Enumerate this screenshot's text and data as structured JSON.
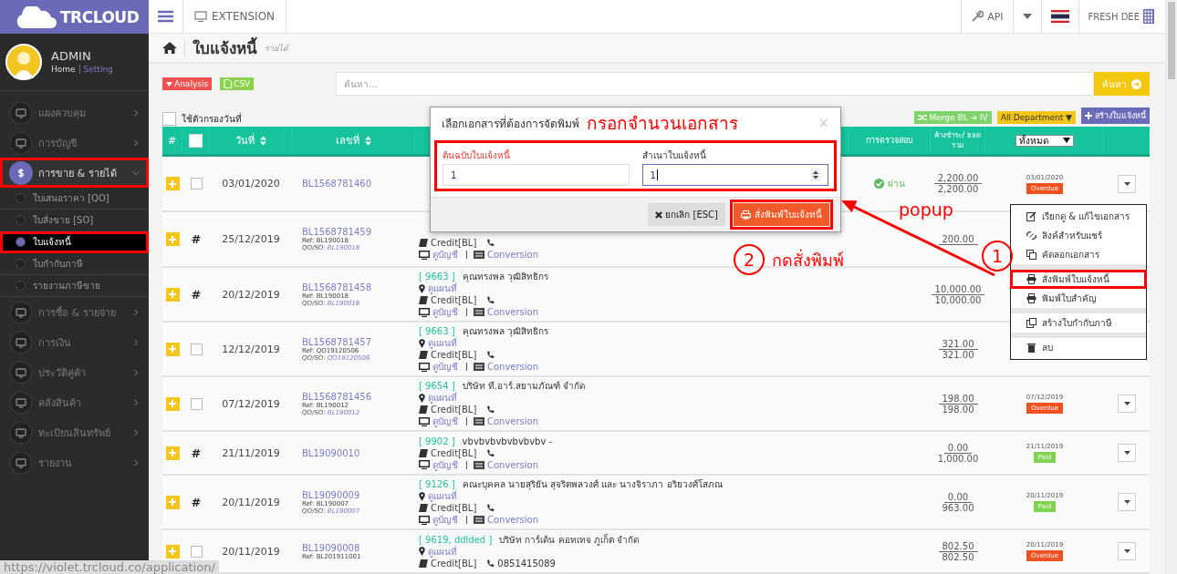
{
  "logo": "TRCLOUD",
  "profile": {
    "name": "ADMIN",
    "home": "Home",
    "setting": "Setting"
  },
  "sidebar": {
    "items": [
      {
        "label": "แผงควบคุม",
        "expanded": false,
        "highlighted": false
      },
      {
        "label": "การบัญชี",
        "expanded": false,
        "highlighted": false
      },
      {
        "label": "การขาย & รายได้",
        "expanded": true,
        "highlighted": true,
        "children": [
          {
            "label": "ใบเสนอราคา [QO]",
            "selected": false,
            "highlighted": false
          },
          {
            "label": "ใบสั่งขาย [SO]",
            "selected": false,
            "highlighted": false
          },
          {
            "label": "ใบแจ้งหนี้",
            "selected": true,
            "highlighted": true
          },
          {
            "label": "ใบกำกับภาษี",
            "selected": false,
            "highlighted": false
          },
          {
            "label": "รายงานภาษีขาย",
            "selected": false,
            "highlighted": false
          }
        ]
      },
      {
        "label": "การซื้อ & รายจ่าย",
        "expanded": false,
        "highlighted": false
      },
      {
        "label": "การเงิน",
        "expanded": false,
        "highlighted": false
      },
      {
        "label": "ประวัติคู่ค้า",
        "expanded": false,
        "highlighted": false
      },
      {
        "label": "คลังสินค้า",
        "expanded": false,
        "highlighted": false
      },
      {
        "label": "ทะเบียนสินทรัพย์",
        "expanded": false,
        "highlighted": false
      },
      {
        "label": "รายงาน",
        "expanded": false,
        "highlighted": false
      }
    ]
  },
  "topbar": {
    "extension": "EXTENSION",
    "api": "API",
    "company": "FRESH DEE"
  },
  "page": {
    "title": "ใบแจ้งหนี้",
    "subtitle": "รายได้"
  },
  "toolbar": {
    "analysis": "Analysis",
    "csv": "CSV",
    "search": {
      "placeholder": "ค้นหา..."
    },
    "search_button": "ค้นหา"
  },
  "filter": {
    "label": "ใช้ตัวกรองวันที่",
    "checked": false
  },
  "actions": {
    "merge": "Merge BL ➔ IV",
    "department": "All Department ▼",
    "create": "สร้างใบแจ้งหนี้"
  },
  "table": {
    "select_all_checked": false,
    "columns": {
      "hash": "#",
      "date": "วันที่",
      "number": "เลขที่",
      "check": "การตรวจสอบ",
      "amount": "ค้างชำระ/ ยอดรวม",
      "status_filter": "ทั้งหมด"
    },
    "rows": [
      {
        "checked": false,
        "date": "03/01/2020",
        "number": "BL1568781460",
        "check": "ผ่าน",
        "outstanding": "2,200.00",
        "total": "2,200.00",
        "status": {
          "date": "03/01/2020",
          "label": "Overdue",
          "kind": "overdue"
        }
      },
      {
        "mark": "#",
        "date": "25/12/2019",
        "number": "BL1568781459",
        "ref": "Ref: BL190018",
        "qo_label": "QO/SO:",
        "qo": "BL190018",
        "customer": {
          "credit": "Credit[BL]",
          "account": "ดูบัญชี",
          "conversion": "Conversion"
        },
        "outstanding": "200.00"
      },
      {
        "mark": "#",
        "date": "20/12/2019",
        "number": "BL1568781458",
        "ref": "Ref: BL190018",
        "qo_label": "QO/SO:",
        "qo": "BL190018",
        "customer": {
          "code": "[ 9663 ]",
          "name": "คุณทรงพล วุฒิสิทธิกร",
          "map": "ดูแผนที่",
          "credit": "Credit[BL]",
          "account": "ดูบัญชี",
          "conversion": "Conversion"
        },
        "outstanding": "10,000.00",
        "total": "10,000.00"
      },
      {
        "checked": false,
        "date": "12/12/2019",
        "number": "BL1568781457",
        "ref": "Ref: QO19120506",
        "qo_label": "QO/SO:",
        "qo": "QO19120506",
        "customer": {
          "code": "[ 9663 ]",
          "name": "คุณทรงพล วุฒิสิทธิกร",
          "map": "ดูแผนที่",
          "credit": "Credit[BL]",
          "account": "ดูบัญชี",
          "conversion": "Conversion"
        },
        "outstanding": "321.00",
        "total": "321.00"
      },
      {
        "checked": false,
        "date": "07/12/2019",
        "number": "BL1568781456",
        "ref": "Ref: BL190012",
        "qo_label": "QO/SO:",
        "qo": "BL190012",
        "customer": {
          "code": "[ 9654 ]",
          "name": "บริษัท ที.อาร์.สยามภัณฑ์ จำกัด",
          "map": "ดูแผนที่",
          "credit": "Credit[BL]",
          "account": "ดูบัญชี",
          "conversion": "Conversion"
        },
        "outstanding": "198.00",
        "total": "198.00",
        "status": {
          "date": "07/12/2019",
          "label": "Overdue",
          "kind": "overdue"
        }
      },
      {
        "mark": "#",
        "date": "21/11/2019",
        "number": "BL19090010",
        "customer": {
          "code": "[ 9902 ]",
          "name": "vbvbvbvbvbvbvbv -",
          "credit": "Credit[BL]",
          "account": "ดูบัญชี",
          "conversion": "Conversion"
        },
        "outstanding": "0.00",
        "total": "1,000.00",
        "status": {
          "date": "21/11/2019",
          "label": "Paid",
          "kind": "paid"
        }
      },
      {
        "mark": "#",
        "date": "20/11/2019",
        "number": "BL19090009",
        "ref": "Ref: BL190007",
        "qo_label": "QO/SO:",
        "qo": "BL190007",
        "customer": {
          "code": "[ 9126 ]",
          "name": "คณะบุคคล นายสุริยัน สุจริตพลวงศ์ และ นางจิราภา อริยวงศ์โสภณ",
          "map": "ดูแผนที่",
          "credit": "Credit[BL]",
          "account": "ดูบัญชี",
          "conversion": "Conversion"
        },
        "outstanding": "0.00",
        "total": "963.00",
        "status": {
          "date": "20/11/2019",
          "label": "Paid",
          "kind": "paid"
        }
      },
      {
        "checked": false,
        "date": "20/11/2019",
        "number": "BL19090008",
        "ref": "Ref: BL201911001",
        "customer": {
          "code": "[ 9619, ddlded ]",
          "name": "บริษัท การ์เด้น คอทเทจ ภูเก็ต จำกัด",
          "map": "ดูแผนที่",
          "credit": "Credit[BL]",
          "phone": "0851415089"
        },
        "outstanding": "802.50",
        "total": "802.50",
        "status": {
          "date": "20/11/2019",
          "label": "Overdue",
          "kind": "overdue"
        }
      }
    ]
  },
  "modal": {
    "title": "เลือกเอกสารที่ต้องการจัดพิมพ์",
    "annotation": "กรอกจำนวนเอกสาร",
    "close": "×",
    "fields_highlighted": true,
    "fields": [
      {
        "label": "ต้นฉบับใบแจ้งหนี้",
        "value": "1",
        "required": true,
        "focused": false
      },
      {
        "label": "สำเนาใบแจ้งหนี้",
        "value": "1",
        "required": false,
        "focused": true
      }
    ],
    "cancel": "ยกเลิก [ESC]",
    "print": {
      "label": "สั่งพิมพ์ใบแจ้งหนี้",
      "highlighted": true
    }
  },
  "menu": {
    "items": [
      {
        "kind": "item",
        "label": "เรียกดู & แก้ไขเอกสาร",
        "highlighted": false
      },
      {
        "kind": "item",
        "label": "ลิงค์สำหรับแชร์",
        "highlighted": false
      },
      {
        "kind": "item",
        "label": "คัดลอกเอกสาร",
        "highlighted": false
      },
      {
        "kind": "divider"
      },
      {
        "kind": "item",
        "label": "สั่งพิมพ์ใบแจ้งหนี้",
        "highlighted": true
      },
      {
        "kind": "item",
        "label": "พิมพ์ใบสำคัญ",
        "highlighted": false
      },
      {
        "kind": "divider"
      },
      {
        "kind": "item",
        "label": "สร้างใบกำกับภาษี",
        "highlighted": false
      },
      {
        "kind": "divider"
      },
      {
        "kind": "item",
        "label": "ลบ",
        "highlighted": false
      }
    ]
  },
  "annotations": [
    {
      "kind": "text",
      "text": "popup"
    },
    {
      "kind": "step",
      "number": "2",
      "text": "กดสั่งพิมพ์"
    },
    {
      "kind": "step",
      "number": "1"
    },
    {
      "kind": "arrow"
    }
  ],
  "status_url": "https://violet.trcloud.co/application/"
}
